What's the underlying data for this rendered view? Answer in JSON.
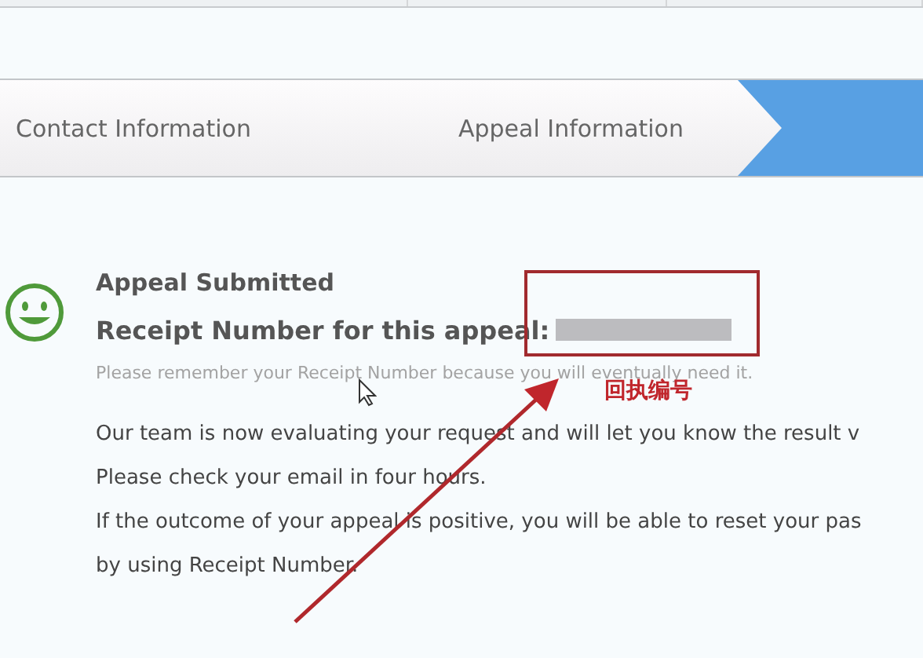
{
  "steps": [
    {
      "label": "Contact Information",
      "selected": false
    },
    {
      "label": "Appeal Information",
      "selected": false
    },
    {
      "selected": true
    }
  ],
  "confirmation": {
    "title": "Appeal Submitted",
    "receipt_label": "Receipt Number for this appeal:",
    "note": "Please remember your Receipt Number because you will eventually need it."
  },
  "message": [
    "Our team is now evaluating your request and will let you know the result v",
    "Please check your email in four hours.",
    "If the outcome of your appeal is positive, you will be able to reset your pas",
    "by using Receipt Number."
  ],
  "annotation": {
    "label": "回执编号"
  }
}
